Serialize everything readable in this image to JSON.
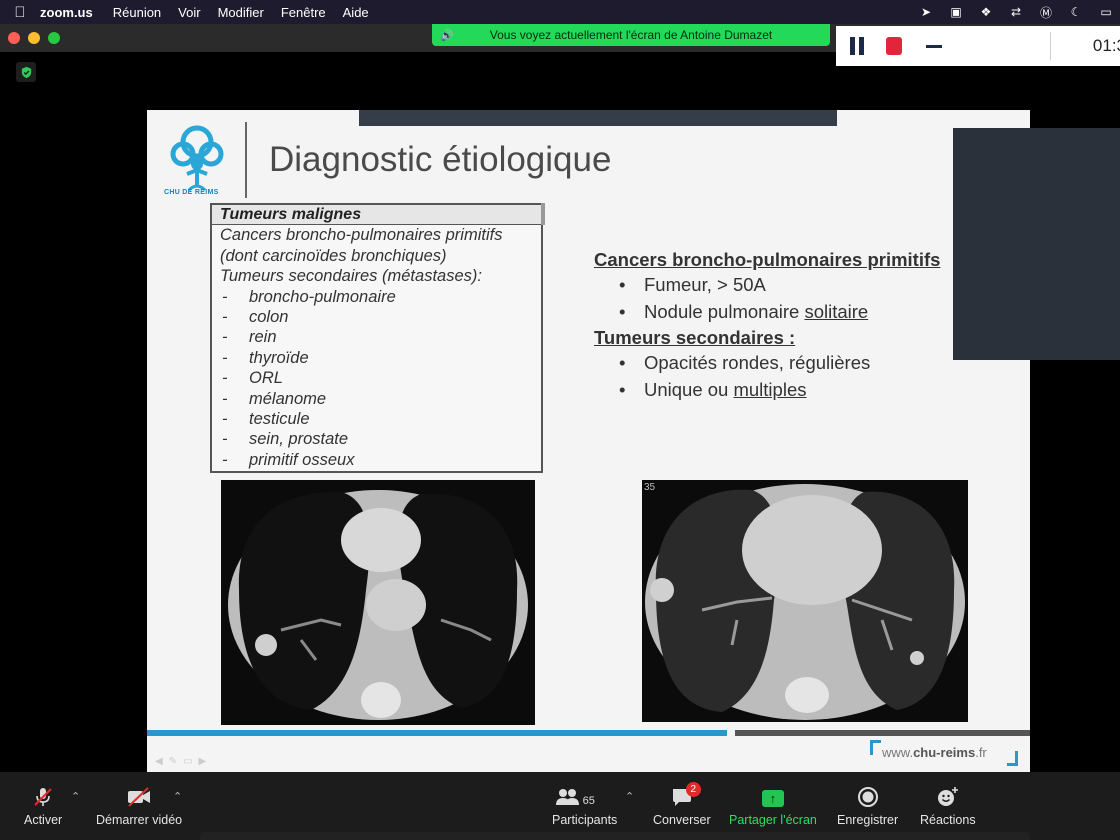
{
  "menubar": {
    "app": "zoom.us",
    "menus": [
      "Réunion",
      "Voir",
      "Modifier",
      "Fenêtre",
      "Aide"
    ]
  },
  "share_banner": "Vous voyez actuellement l'écran de Antoine Dumazet",
  "recording": {
    "time": "01:3"
  },
  "slide": {
    "logo_caption": "CHU DE REIMS",
    "title": "Diagnostic étiologique",
    "box": {
      "header": "Tumeurs malignes",
      "lines": [
        "Cancers broncho-pulmonaires primitifs",
        "(dont carcinoïdes bronchiques)",
        "Tumeurs secondaires (métastases):"
      ],
      "items": [
        "broncho-pulmonaire",
        "colon",
        "rein",
        "thyroïde",
        "ORL",
        "mélanome",
        "testicule",
        "sein, prostate",
        "primitif osseux"
      ]
    },
    "right": {
      "h1": "Cancers broncho-pulmonaires primitifs",
      "b1": "Fumeur, > 50A",
      "b2_pre": "Nodule pulmonaire ",
      "b2_ul": "solitaire",
      "h2": "Tumeurs secondaires :",
      "b3": "Opacités rondes, régulières",
      "b4_pre": "Unique ou ",
      "b4_ul": "multiples"
    },
    "ct2_label": "35",
    "footer_url_pre": "www.",
    "footer_url_bold": "chu-reims",
    "footer_url_post": ".fr"
  },
  "toolbar": {
    "mute": "Activer",
    "video": "Démarrer vidéo",
    "participants": "Participants",
    "participants_count": "65",
    "chat": "Converser",
    "chat_badge": "2",
    "share": "Partager l'écran",
    "record": "Enregistrer",
    "reactions": "Réactions"
  },
  "colors": {
    "share_green": "#23d959",
    "slide_accent": "#2b96c9",
    "record_red": "#e0263b"
  }
}
